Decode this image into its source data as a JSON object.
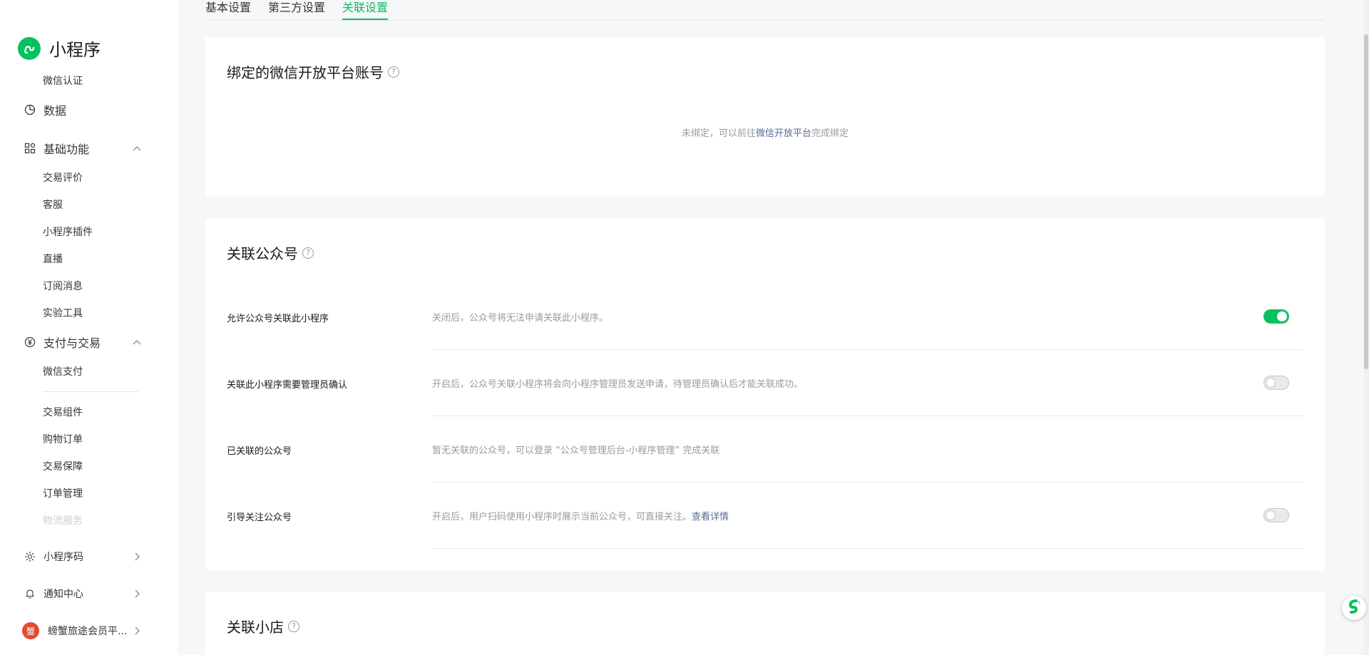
{
  "app": {
    "name": "小程序"
  },
  "sidebar": {
    "top_item": "微信认证",
    "data_item": "数据",
    "basic_group": "基础功能",
    "basic_items": [
      "交易评价",
      "客服",
      "小程序插件",
      "直播",
      "订阅消息",
      "实验工具"
    ],
    "pay_group": "支付与交易",
    "pay_items_a": [
      "微信支付"
    ],
    "pay_items_b": [
      "交易组件",
      "购物订单",
      "交易保障",
      "订单管理",
      "物流服务"
    ],
    "qrcode_item": "小程序码",
    "notify_item": "通知中心",
    "account_name": "螃蟹旅途会员平...",
    "avatar_glyph": "蟹"
  },
  "tabs": [
    "基本设置",
    "第三方设置",
    "关联设置"
  ],
  "active_tab": "关联设置",
  "open_platform": {
    "title": "绑定的微信开放平台账号",
    "help": "?",
    "note_prefix": "未绑定，可以前往",
    "note_link": "微信开放平台",
    "note_suffix": "完成绑定"
  },
  "official_account": {
    "title": "关联公众号",
    "help": "?",
    "rows": [
      {
        "label": "允许公众号关联此小程序",
        "desc": "关闭后，公众号将无法申请关联此小程序。",
        "toggle": "on"
      },
      {
        "label": "关联此小程序需要管理员确认",
        "desc": "开启后，公众号关联小程序将会向小程序管理员发送申请，待管理员确认后才能关联成功。",
        "toggle": "off"
      },
      {
        "label": "已关联的公众号",
        "desc": "暂无关联的公众号，可以登录 “公众号管理后台-小程序管理” 完成关联"
      },
      {
        "label": "引导关注公众号",
        "desc": "开启后，用户扫码使用小程序时展示当前公众号，可直接关注。",
        "link": "查看详情",
        "toggle": "off"
      }
    ]
  },
  "shop": {
    "title": "关联小店",
    "help": "?"
  },
  "colors": {
    "accent": "#07c160",
    "link": "#576b95",
    "muted": "#9a9a9a",
    "background": "#f6f7f9"
  },
  "icons": [
    "mini-program-logo-icon",
    "pie-chart-icon",
    "grid-icon",
    "yuan-circle-icon",
    "sun-qrcode-icon",
    "bell-icon",
    "chevron-up-icon",
    "chevron-right-icon",
    "help-circle-icon"
  ]
}
